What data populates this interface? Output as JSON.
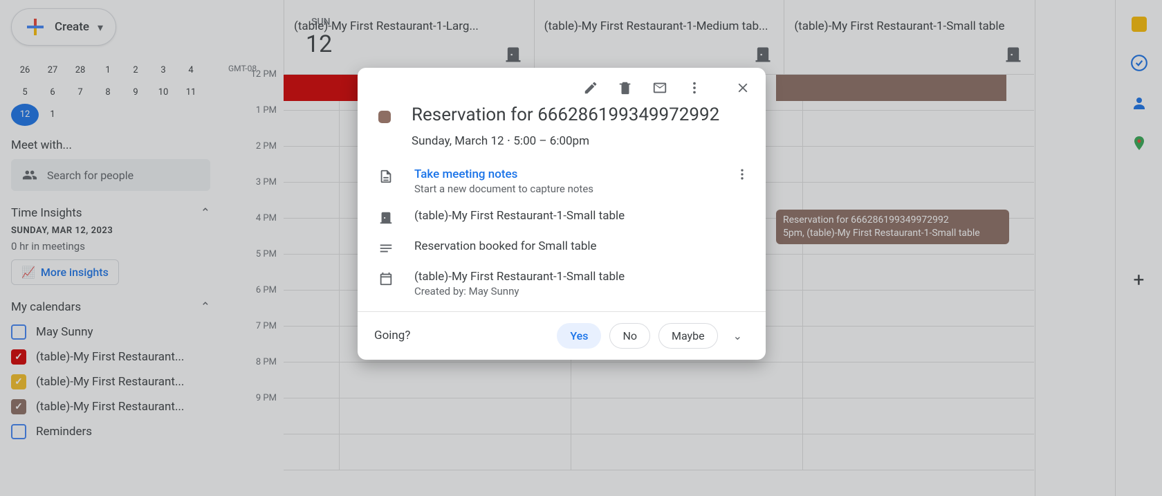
{
  "create_label": "Create",
  "mini_cal": [
    "26",
    "27",
    "28",
    "1",
    "2",
    "3",
    "4",
    "5",
    "6",
    "7",
    "8",
    "9",
    "10",
    "11",
    "12",
    "1"
  ],
  "meet_with": "Meet with...",
  "search_people_placeholder": "Search for people",
  "time_insights": {
    "header": "Time Insights",
    "date": "SUNDAY, MAR 12, 2023",
    "hours": "0 hr in meetings",
    "more": "More insights"
  },
  "my_calendars": {
    "header": "My calendars",
    "items": [
      {
        "label": "May Sunny",
        "color": "#4285f4",
        "checked": false
      },
      {
        "label": "(table)-My First Restaurant...",
        "color": "#d50000",
        "checked": true
      },
      {
        "label": "(table)-My First Restaurant...",
        "color": "#f6bf26",
        "checked": true
      },
      {
        "label": "(table)-My First Restaurant...",
        "color": "#8d6e63",
        "checked": true
      },
      {
        "label": "Reminders",
        "color": "#4285f4",
        "checked": false
      }
    ]
  },
  "timezone": "GMT-08",
  "day": {
    "name": "SUN",
    "num": "12"
  },
  "resources": [
    "(table)-My First Restaurant-1-Larg...",
    "(table)-My First Restaurant-1-Medium tab...",
    "(table)-My First Restaurant-1-Small table"
  ],
  "hours": [
    "12 PM",
    "1 PM",
    "2 PM",
    "3 PM",
    "4 PM",
    "5 PM",
    "6 PM",
    "7 PM",
    "8 PM",
    "9 PM"
  ],
  "event_chip": {
    "title": "Reservation for 666286199349972992",
    "sub": "5pm, (table)-My First Restaurant-1-Small table"
  },
  "popup": {
    "title": "Reservation for 666286199349972992",
    "datetime": "Sunday, March 12   ⋅   5:00 – 6:00pm",
    "notes_link": "Take meeting notes",
    "notes_sub": "Start a new document to capture notes",
    "room": "(table)-My First Restaurant-1-Small table",
    "description": "Reservation booked for Small table",
    "calendar": "(table)-My First Restaurant-1-Small table",
    "created_by": "Created by: May Sunny",
    "going": "Going?",
    "yes": "Yes",
    "no": "No",
    "maybe": "Maybe"
  }
}
